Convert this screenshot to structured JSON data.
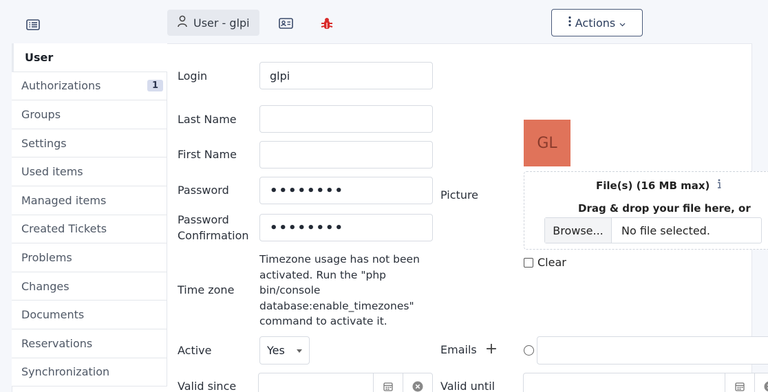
{
  "topbar": {
    "tab_label": "User - glpi",
    "actions_label": "Actions"
  },
  "sidebar": {
    "items": [
      {
        "label": "User",
        "active": true
      },
      {
        "label": "Authorizations",
        "badge": "1"
      },
      {
        "label": "Groups"
      },
      {
        "label": "Settings"
      },
      {
        "label": "Used items"
      },
      {
        "label": "Managed items"
      },
      {
        "label": "Created Tickets"
      },
      {
        "label": "Problems"
      },
      {
        "label": "Changes"
      },
      {
        "label": "Documents"
      },
      {
        "label": "Reservations"
      },
      {
        "label": "Synchronization"
      }
    ]
  },
  "form": {
    "login_label": "Login",
    "login_value": "glpi",
    "last_name_label": "Last Name",
    "last_name_value": "",
    "first_name_label": "First Name",
    "first_name_value": "",
    "password_label": "Password",
    "password_value": "••••••••",
    "password_confirm_label_1": "Password",
    "password_confirm_label_2": "Confirmation",
    "password_confirm_value": "••••••••",
    "timezone_label": "Time zone",
    "timezone_note": "Timezone usage has not been activated. Run the \"php bin/console database:enable_timezones\" command to activate it.",
    "active_label": "Active",
    "active_value": "Yes",
    "valid_since_label": "Valid since",
    "valid_until_label": "Valid until",
    "picture_label": "Picture",
    "avatar_initials": "GL",
    "avatar_color": "#e0735a",
    "files_title": "File(s) (16 MB max)",
    "drag_text": "Drag & drop your file here, or",
    "browse_label": "Browse...",
    "no_file_text": "No file selected.",
    "clear_label": "Clear",
    "emails_label": "Emails"
  }
}
